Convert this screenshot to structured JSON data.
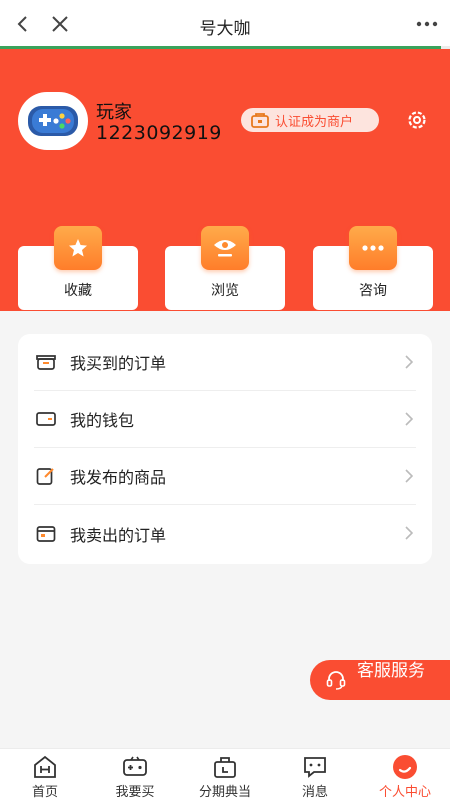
{
  "topbar": {
    "title": "号大咖",
    "back_icon": "chevron-left-icon",
    "close_icon": "close-icon",
    "more_icon": "more-dots-icon"
  },
  "profile": {
    "name": "玩家",
    "id": "1223092919",
    "merchant_label": "认证成为商户",
    "avatar_icon": "gamepad-icon",
    "settings_icon": "gear-icon"
  },
  "quick_actions": [
    {
      "label": "收藏",
      "icon": "star-icon"
    },
    {
      "label": "浏览",
      "icon": "eye-icon"
    },
    {
      "label": "咨询",
      "icon": "chat-bubble-icon"
    }
  ],
  "menu": [
    {
      "label": "我买到的订单",
      "icon": "box-icon"
    },
    {
      "label": "我的钱包",
      "icon": "wallet-icon"
    },
    {
      "label": "我发布的商品",
      "icon": "edit-icon"
    },
    {
      "label": "我卖出的订单",
      "icon": "order-icon"
    }
  ],
  "customer_service": {
    "label": "客服服务",
    "icon": "headset-icon"
  },
  "tabbar": [
    {
      "label": "首页",
      "icon": "home-icon",
      "active": false
    },
    {
      "label": "我要买",
      "icon": "gamepad-tab-icon",
      "active": false
    },
    {
      "label": "分期典当",
      "icon": "bag-icon",
      "active": false
    },
    {
      "label": "消息",
      "icon": "message-icon",
      "active": false
    },
    {
      "label": "个人中心",
      "icon": "profile-icon",
      "active": true
    }
  ],
  "colors": {
    "brand": "#fa4d32",
    "accent_orange": "#ff8a2e",
    "progress_green": "#3aa35b"
  },
  "page_load_progress": 0.98
}
